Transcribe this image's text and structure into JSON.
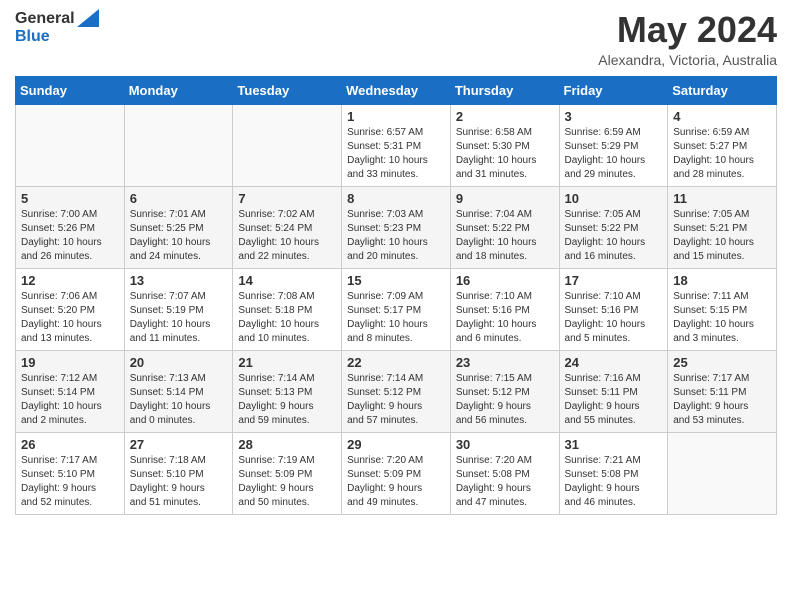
{
  "header": {
    "logo_general": "General",
    "logo_blue": "Blue",
    "month_title": "May 2024",
    "location": "Alexandra, Victoria, Australia"
  },
  "weekdays": [
    "Sunday",
    "Monday",
    "Tuesday",
    "Wednesday",
    "Thursday",
    "Friday",
    "Saturday"
  ],
  "weeks": [
    [
      {
        "day": "",
        "info": ""
      },
      {
        "day": "",
        "info": ""
      },
      {
        "day": "",
        "info": ""
      },
      {
        "day": "1",
        "info": "Sunrise: 6:57 AM\nSunset: 5:31 PM\nDaylight: 10 hours\nand 33 minutes."
      },
      {
        "day": "2",
        "info": "Sunrise: 6:58 AM\nSunset: 5:30 PM\nDaylight: 10 hours\nand 31 minutes."
      },
      {
        "day": "3",
        "info": "Sunrise: 6:59 AM\nSunset: 5:29 PM\nDaylight: 10 hours\nand 29 minutes."
      },
      {
        "day": "4",
        "info": "Sunrise: 6:59 AM\nSunset: 5:27 PM\nDaylight: 10 hours\nand 28 minutes."
      }
    ],
    [
      {
        "day": "5",
        "info": "Sunrise: 7:00 AM\nSunset: 5:26 PM\nDaylight: 10 hours\nand 26 minutes."
      },
      {
        "day": "6",
        "info": "Sunrise: 7:01 AM\nSunset: 5:25 PM\nDaylight: 10 hours\nand 24 minutes."
      },
      {
        "day": "7",
        "info": "Sunrise: 7:02 AM\nSunset: 5:24 PM\nDaylight: 10 hours\nand 22 minutes."
      },
      {
        "day": "8",
        "info": "Sunrise: 7:03 AM\nSunset: 5:23 PM\nDaylight: 10 hours\nand 20 minutes."
      },
      {
        "day": "9",
        "info": "Sunrise: 7:04 AM\nSunset: 5:22 PM\nDaylight: 10 hours\nand 18 minutes."
      },
      {
        "day": "10",
        "info": "Sunrise: 7:05 AM\nSunset: 5:22 PM\nDaylight: 10 hours\nand 16 minutes."
      },
      {
        "day": "11",
        "info": "Sunrise: 7:05 AM\nSunset: 5:21 PM\nDaylight: 10 hours\nand 15 minutes."
      }
    ],
    [
      {
        "day": "12",
        "info": "Sunrise: 7:06 AM\nSunset: 5:20 PM\nDaylight: 10 hours\nand 13 minutes."
      },
      {
        "day": "13",
        "info": "Sunrise: 7:07 AM\nSunset: 5:19 PM\nDaylight: 10 hours\nand 11 minutes."
      },
      {
        "day": "14",
        "info": "Sunrise: 7:08 AM\nSunset: 5:18 PM\nDaylight: 10 hours\nand 10 minutes."
      },
      {
        "day": "15",
        "info": "Sunrise: 7:09 AM\nSunset: 5:17 PM\nDaylight: 10 hours\nand 8 minutes."
      },
      {
        "day": "16",
        "info": "Sunrise: 7:10 AM\nSunset: 5:16 PM\nDaylight: 10 hours\nand 6 minutes."
      },
      {
        "day": "17",
        "info": "Sunrise: 7:10 AM\nSunset: 5:16 PM\nDaylight: 10 hours\nand 5 minutes."
      },
      {
        "day": "18",
        "info": "Sunrise: 7:11 AM\nSunset: 5:15 PM\nDaylight: 10 hours\nand 3 minutes."
      }
    ],
    [
      {
        "day": "19",
        "info": "Sunrise: 7:12 AM\nSunset: 5:14 PM\nDaylight: 10 hours\nand 2 minutes."
      },
      {
        "day": "20",
        "info": "Sunrise: 7:13 AM\nSunset: 5:14 PM\nDaylight: 10 hours\nand 0 minutes."
      },
      {
        "day": "21",
        "info": "Sunrise: 7:14 AM\nSunset: 5:13 PM\nDaylight: 9 hours\nand 59 minutes."
      },
      {
        "day": "22",
        "info": "Sunrise: 7:14 AM\nSunset: 5:12 PM\nDaylight: 9 hours\nand 57 minutes."
      },
      {
        "day": "23",
        "info": "Sunrise: 7:15 AM\nSunset: 5:12 PM\nDaylight: 9 hours\nand 56 minutes."
      },
      {
        "day": "24",
        "info": "Sunrise: 7:16 AM\nSunset: 5:11 PM\nDaylight: 9 hours\nand 55 minutes."
      },
      {
        "day": "25",
        "info": "Sunrise: 7:17 AM\nSunset: 5:11 PM\nDaylight: 9 hours\nand 53 minutes."
      }
    ],
    [
      {
        "day": "26",
        "info": "Sunrise: 7:17 AM\nSunset: 5:10 PM\nDaylight: 9 hours\nand 52 minutes."
      },
      {
        "day": "27",
        "info": "Sunrise: 7:18 AM\nSunset: 5:10 PM\nDaylight: 9 hours\nand 51 minutes."
      },
      {
        "day": "28",
        "info": "Sunrise: 7:19 AM\nSunset: 5:09 PM\nDaylight: 9 hours\nand 50 minutes."
      },
      {
        "day": "29",
        "info": "Sunrise: 7:20 AM\nSunset: 5:09 PM\nDaylight: 9 hours\nand 49 minutes."
      },
      {
        "day": "30",
        "info": "Sunrise: 7:20 AM\nSunset: 5:08 PM\nDaylight: 9 hours\nand 47 minutes."
      },
      {
        "day": "31",
        "info": "Sunrise: 7:21 AM\nSunset: 5:08 PM\nDaylight: 9 hours\nand 46 minutes."
      },
      {
        "day": "",
        "info": ""
      }
    ]
  ]
}
